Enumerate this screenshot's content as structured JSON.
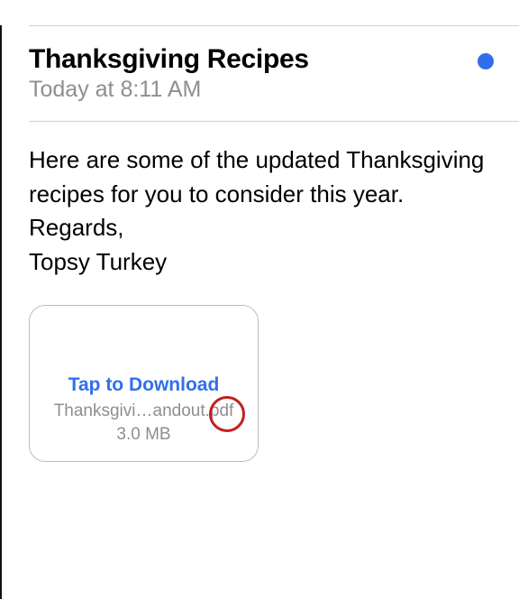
{
  "header": {
    "subject": "Thanksgiving Recipes",
    "timestamp": "Today at 8:11 AM"
  },
  "body": {
    "line1": "Here are some of the updated Thanksgiving recipes for you to consider this year.",
    "line2": "Regards,",
    "line3": "Topsy Turkey"
  },
  "attachment": {
    "action_label": "Tap to Download",
    "filename": "Thanksgivi…andout.pdf",
    "filesize": "3.0 MB"
  }
}
